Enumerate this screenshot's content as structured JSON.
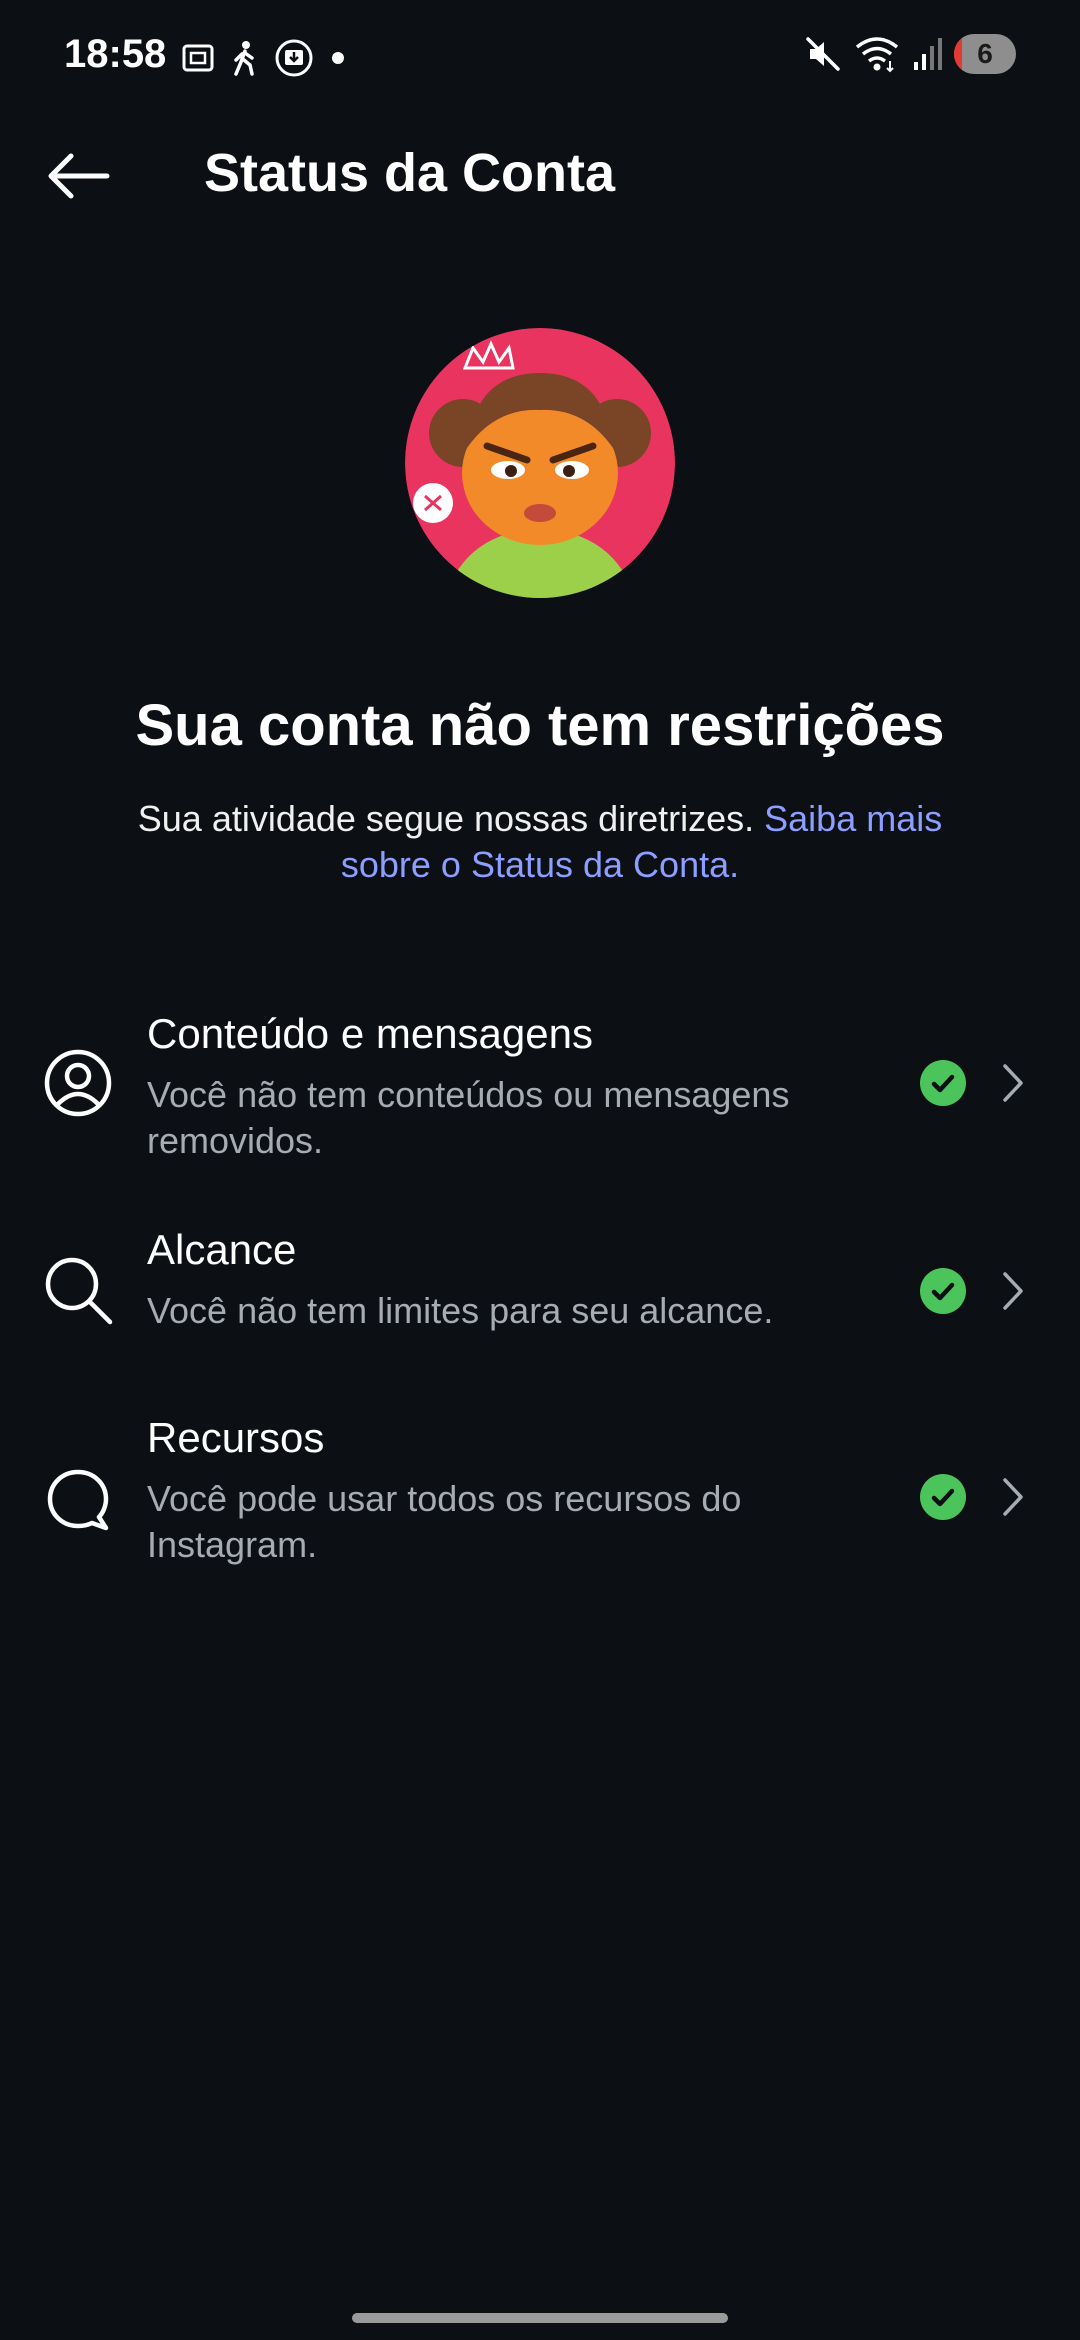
{
  "status_bar": {
    "time": "18:58",
    "battery_level": "6",
    "icons": [
      "screenshot-icon",
      "walking-icon",
      "download-icon",
      "dot-icon",
      "mute-icon",
      "wifi-icon",
      "signal-icon",
      "battery-icon"
    ]
  },
  "header": {
    "title": "Status da Conta",
    "back_icon": "arrow-left-icon"
  },
  "main": {
    "headline": "Sua conta não tem restrições",
    "subtext": "Sua atividade segue nossas diretrizes.",
    "link_text": "Saiba mais sobre o Status da Conta."
  },
  "items": [
    {
      "title": "Conteúdo e mensagens",
      "description": "Você não tem conteúdos ou mensagens removidos.",
      "icon": "user-circle-icon",
      "status": "ok"
    },
    {
      "title": "Alcance",
      "description": "Você não tem limites para seu alcance.",
      "icon": "search-icon",
      "status": "ok"
    },
    {
      "title": "Recursos",
      "description": "Você pode usar todos os recursos do Instagram.",
      "icon": "message-bubble-icon",
      "status": "ok"
    }
  ],
  "colors": {
    "background": "#0c0f14",
    "link": "#8c9eff",
    "check": "#4cc45c",
    "avatar_bg": "#e8345f"
  }
}
